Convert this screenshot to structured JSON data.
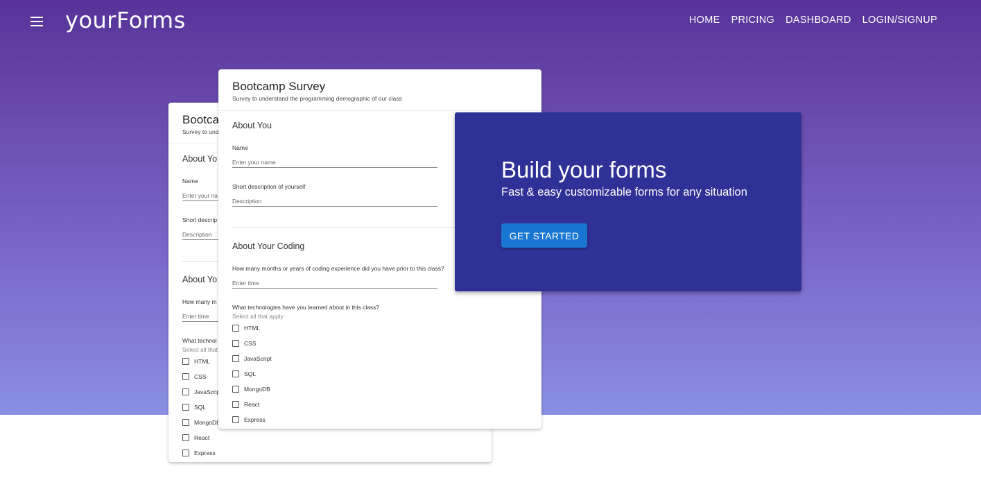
{
  "header": {
    "logo": "yourForms",
    "menu_icon": "hamburger-menu-icon",
    "nav": [
      "HOME",
      "PRICING",
      "DASHBOARD",
      "LOGIN/SIGNUP"
    ]
  },
  "form": {
    "title": "Bootcamp Survey",
    "subtitle": "Survey to understand the programming demographic of our class",
    "section1": "About You",
    "name_label": "Name",
    "name_placeholder": "Enter your name",
    "desc_label": "Short description of yourself",
    "desc_placeholder": "Description",
    "section2": "About Your Coding",
    "exp_label": "How many months or years of coding experience did you have prior to this class?",
    "exp_placeholder": "Enter time",
    "tech_label": "What technologies have you learned about in this class?",
    "tech_hint": "Select all that apply",
    "tech_options": [
      "HTML",
      "CSS",
      "JavaScript",
      "SQL",
      "MongoDB",
      "React",
      "Express"
    ]
  },
  "back_form": {
    "title": "Bootca",
    "subtitle": "Survey to und",
    "section1": "About Yo",
    "name_label": "Name",
    "name_placeholder": "Enter your na",
    "desc_label": "Short descrip",
    "desc_placeholder": "Description",
    "section2": "About Yo",
    "exp_label": "How many m",
    "exp_placeholder": "Enter time",
    "tech_label": "What technol",
    "tech_hint": "Select all that",
    "tech_options": [
      "HTML",
      "CSS",
      "JavaScrip",
      "SQL",
      "MongoDB",
      "React",
      "Express"
    ]
  },
  "promo": {
    "headline": "Build your forms",
    "tagline": "Fast & easy customizable forms for any situation",
    "cta": "GET STARTED",
    "background_color": "#303196",
    "button_color": "#1976d2"
  }
}
